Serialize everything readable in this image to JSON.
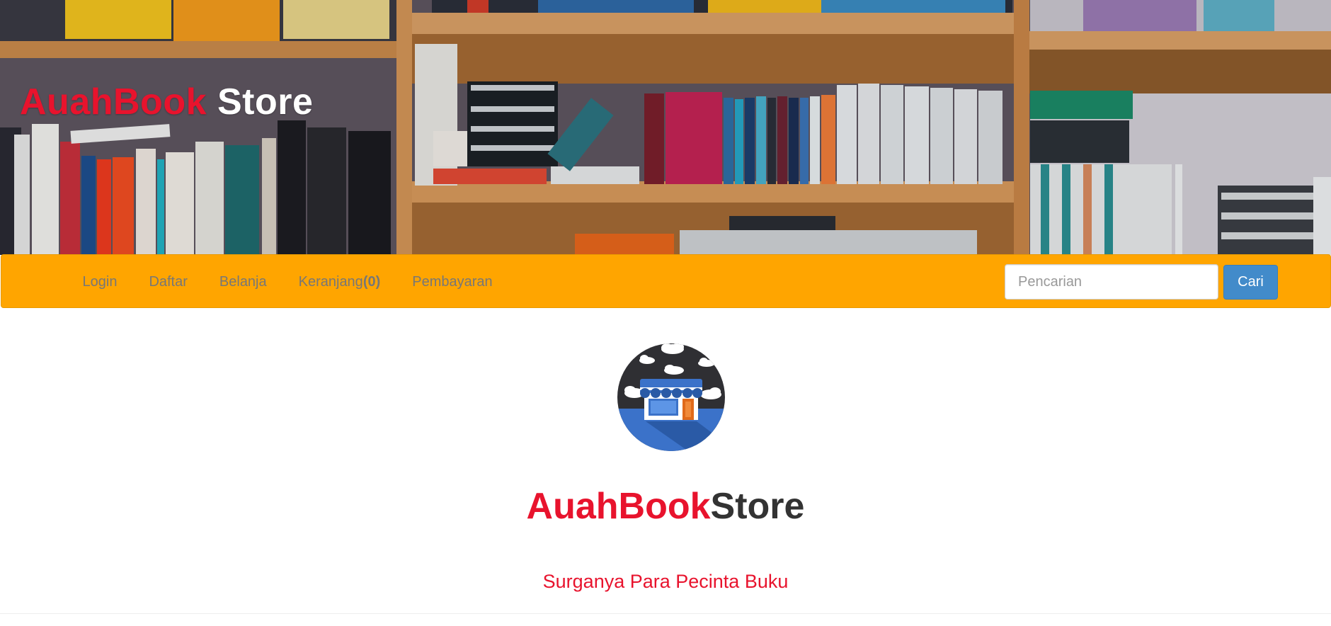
{
  "header": {
    "brand_part1": "AuahBook",
    "brand_part2": " Store"
  },
  "nav": {
    "items": [
      {
        "label": "Login"
      },
      {
        "label": "Daftar"
      },
      {
        "label": "Belanja"
      },
      {
        "label": "Keranjang",
        "count": "(0)"
      },
      {
        "label": "Pembayaran"
      }
    ],
    "search": {
      "placeholder": "Pencarian",
      "value": "",
      "button_label": "Cari"
    }
  },
  "hero": {
    "logo_icon": "store-icon",
    "title_part1": "AuahBook",
    "title_part2": "Store",
    "tagline": "Surganya Para Pecinta Buku"
  },
  "colors": {
    "brand_red": "#e8132d",
    "navbar_orange": "#ffa500",
    "button_blue": "#428bca",
    "logo_circle": "#2f2f33",
    "logo_blue": "#3b72c9"
  }
}
